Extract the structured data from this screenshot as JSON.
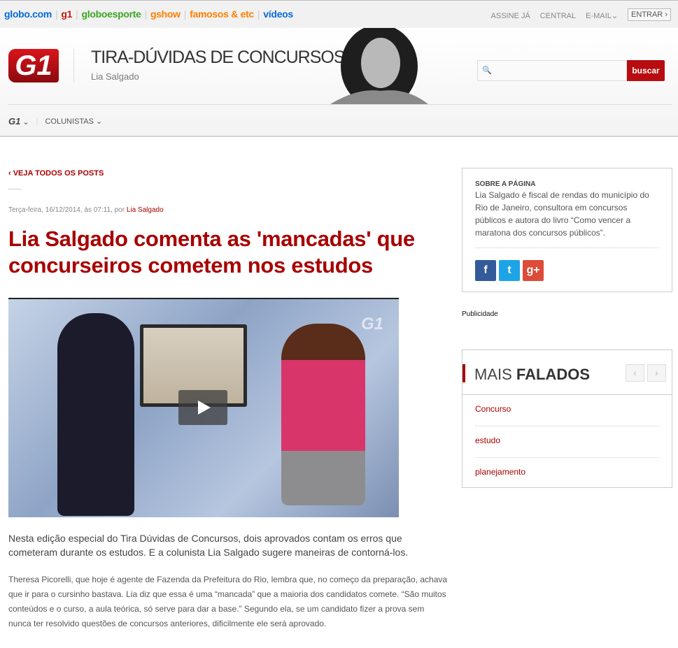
{
  "topbar": {
    "brands": [
      {
        "label": "globo.com",
        "color": "#0669de"
      },
      {
        "label": "g1",
        "color": "#c4170c"
      },
      {
        "label": "globoesporte",
        "color": "#39a823"
      },
      {
        "label": "gshow",
        "color": "#ff7f00"
      },
      {
        "label": "famosos & etc",
        "color": "#ff7f00"
      },
      {
        "label": "vídeos",
        "color": "#0669de"
      }
    ],
    "links": {
      "subscribe": "ASSINE JÁ",
      "central": "CENTRAL",
      "email": "E-MAIL",
      "login": "ENTRAR ›"
    }
  },
  "header": {
    "logo": "G1",
    "title": "TIRA-DÚVIDAS DE CONCURSOS",
    "author": "Lia Salgado",
    "search_placeholder": "",
    "search_button": "buscar"
  },
  "nav": {
    "g1": "G1",
    "columnists": "COLUNISTAS"
  },
  "article": {
    "back": "‹ VEJA TODOS OS POSTS",
    "date": "Terça-feira, 16/12/2014, às 07:11, por",
    "author": "Lia Salgado",
    "title": "Lia Salgado comenta as 'mancadas' que concurseiros cometem nos estudos",
    "video_watermark": "G1",
    "lead": "Nesta edição especial do Tira Dúvidas de Concursos, dois aprovados contam os erros que cometeram durante os estudos. E a colunista Lia Salgado sugere maneiras de contorná-los.",
    "body": "Theresa Picorelli, que hoje é agente de Fazenda da Prefeitura do Rio, lembra que, no começo da preparação, achava que ir para o cursinho bastava. Lia diz que essa é uma “mancada” que a maioria dos candidatos comete. “São muitos conteúdos e o curso, a aula teórica, só serve para dar a base.” Segundo ela, se um candidato fizer a prova sem nunca ter resolvido questões de concursos anteriores, dificilmente ele será aprovado."
  },
  "sidebar": {
    "about_title": "SOBRE A PÁGINA",
    "about_text": "Lia Salgado é fiscal de rendas do município do Rio de Janeiro, consultora em concursos públicos e autora do livro “Como vencer a maratona dos concursos públicos”.",
    "social": {
      "facebook": "f",
      "twitter": "t",
      "gplus": "g+"
    },
    "ad_label": "Publicidade",
    "mais_light": "MAIS ",
    "mais_bold": "FALADOS",
    "prev": "‹",
    "next": "›",
    "topics": [
      "Concurso",
      "estudo",
      "planejamento"
    ]
  }
}
